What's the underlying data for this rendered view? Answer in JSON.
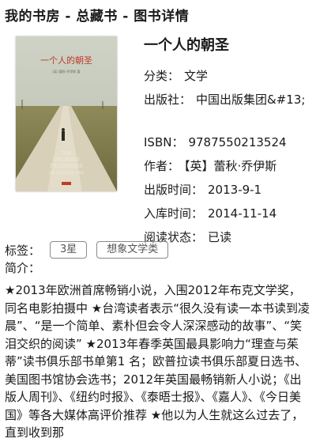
{
  "header": {
    "title": "我的书房 - 总藏书 - 图书详情"
  },
  "cover": {
    "title_cn": "一个人的朝圣",
    "title_en_lines": [
      "THE",
      "UNLIKELY",
      "PILGRIMAGE",
      "OF HAROLD FRY"
    ]
  },
  "book": {
    "title": "一个人的朝圣",
    "category_label": "分类：",
    "category": "文学",
    "publisher_label": "出版社：",
    "publisher": "中国出版集团&#13;",
    "isbn_label": "ISBN：",
    "isbn": "9787550213524",
    "author_label": "作者：",
    "author": "【英】蕾秋·乔伊斯",
    "pubdate_label": "出版时间：",
    "pubdate": "2013-9-1",
    "stockdate_label": "入库时间：",
    "stockdate": "2014-11-14",
    "status_label": "阅读状态：",
    "status": "已读"
  },
  "tags": {
    "label": "标签：",
    "items": [
      "3星",
      "想象文学类"
    ]
  },
  "intro": {
    "label": "简介：",
    "text": "★2013年欧洲首席畅销小说，入围2012年布克文学奖，同名电影拍摄中 ★台湾读者表示“很久没有读一本书读到凌晨”、“是一个简单、素朴但会令人深深感动的故事”、“笑泪交织的阅读” ★2013年春季英国最具影响力“理查与茱蒂”读书俱乐部书单第1 名；欧普拉读书俱乐部夏日选书、美国图书馆协会选书；2012年英国最畅销新人小说；《出版人周刊》、《纽约时报》、《泰晤士报》、《嘉人》、《今日美国》等各大媒体高评价推荐 ★他以为人生就这么过去了，直到收到那"
  },
  "colors": {
    "cover_sky": "#c4c9b8",
    "cover_road": "#d9d2bd",
    "cover_title": "#c0392b",
    "cover_field": "#8b8654"
  }
}
